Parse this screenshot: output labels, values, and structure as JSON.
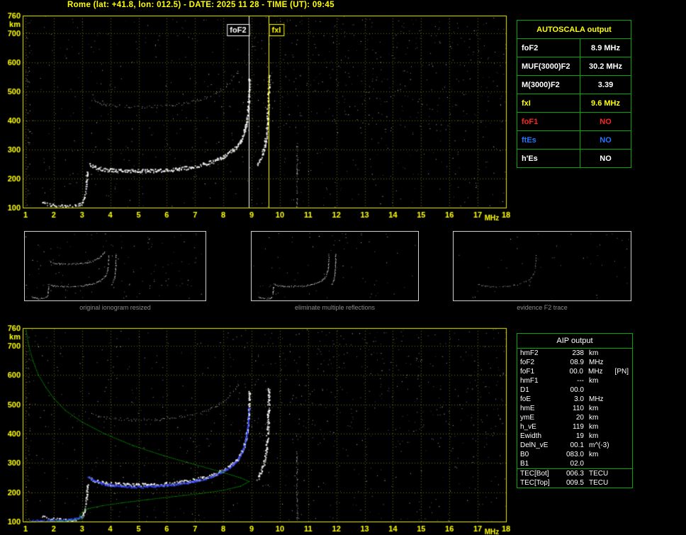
{
  "title": "Rome (lat: +41.8, lon: 012.5) - DATE: 2025 11 28 - TIME (UT): 09:45",
  "autoscala_table": {
    "header": "AUTOSCALA output",
    "rows": [
      {
        "label": "foF2",
        "value": "8.9 MHz",
        "color": "#ffffff"
      },
      {
        "label": "MUF(3000)F2",
        "value": "30.2 MHz",
        "color": "#ffffff"
      },
      {
        "label": "M(3000)F2",
        "value": "3.39",
        "color": "#ffffff"
      },
      {
        "label": "fxI",
        "value": "9.6 MHz",
        "color": "#ffff00"
      },
      {
        "label": "foF1",
        "value": "NO",
        "color": "#ff2222"
      },
      {
        "label": "ftEs",
        "value": "NO",
        "color": "#2277ff"
      },
      {
        "label": "h'Es",
        "value": "NO",
        "color": "#ffffff"
      }
    ]
  },
  "aip_table": {
    "header": "AIP output",
    "rows": [
      {
        "name": "hmF2",
        "value": "238",
        "unit": "km",
        "extra": "",
        "section": 1
      },
      {
        "name": "foF2",
        "value": "08.9",
        "unit": "MHz",
        "extra": "",
        "section": 1
      },
      {
        "name": "foF1",
        "value": "00.0",
        "unit": "MHz",
        "extra": "[PN]",
        "section": 1
      },
      {
        "name": "hmF1",
        "value": "---",
        "unit": "km",
        "extra": "",
        "section": 1
      },
      {
        "name": "D1",
        "value": "00.0",
        "unit": "",
        "extra": "",
        "section": 1
      },
      {
        "name": "foE",
        "value": "3.0",
        "unit": "MHz",
        "extra": "",
        "section": 1
      },
      {
        "name": "hmE",
        "value": "110",
        "unit": "km",
        "extra": "",
        "section": 1
      },
      {
        "name": "ymE",
        "value": "20",
        "unit": "km",
        "extra": "",
        "section": 1
      },
      {
        "name": "h_vE",
        "value": "119",
        "unit": "km",
        "extra": "",
        "section": 1
      },
      {
        "name": "Ewidth",
        "value": "19",
        "unit": "km",
        "extra": "",
        "section": 1
      },
      {
        "name": "DelN_vE",
        "value": "00.1",
        "unit": "m^(-3)",
        "extra": "",
        "section": 1
      },
      {
        "name": "B0",
        "value": "083.0",
        "unit": "km",
        "extra": "",
        "section": 1
      },
      {
        "name": "B1",
        "value": "02.0",
        "unit": "",
        "extra": "",
        "section": 1
      },
      {
        "name": "TEC[Bot]",
        "value": "006.3",
        "unit": "TECU",
        "extra": "",
        "section": 2
      },
      {
        "name": "TEC[Top]",
        "value": "009.5",
        "unit": "TECU",
        "extra": "",
        "section": 2
      }
    ]
  },
  "thumbnails": [
    {
      "caption": "original ionogram resized"
    },
    {
      "caption": "eliminate multiple reflections"
    },
    {
      "caption": "evidence F2 trace"
    }
  ],
  "chart_data": [
    {
      "id": "ionogram_autoscala",
      "type": "scatter",
      "xlabel": "MHz",
      "ylabel": "km",
      "xlim": [
        1,
        18
      ],
      "ylim": [
        100,
        760
      ],
      "x_ticks": [
        1,
        2,
        3,
        4,
        5,
        6,
        7,
        8,
        9,
        10,
        11,
        12,
        13,
        14,
        15,
        16,
        17,
        18
      ],
      "y_ticks": [
        100,
        200,
        300,
        400,
        500,
        600,
        700,
        760
      ],
      "grid": true,
      "axis_color": "#ffff00",
      "interference_mhz": 10.6,
      "markers": [
        {
          "label": "foF2",
          "freq_mhz": 8.9,
          "color": "#ffffff",
          "align": "left"
        },
        {
          "label": "fxI",
          "freq_mhz": 9.6,
          "color": "#ffff00",
          "align": "right"
        }
      ],
      "series": [
        {
          "name": "E-trace",
          "points": [
            [
              1.6,
              118
            ],
            [
              1.85,
              112
            ],
            [
              2.15,
              108
            ],
            [
              2.5,
              106
            ],
            [
              2.8,
              110
            ],
            [
              3.0,
              118
            ],
            [
              3.08,
              136
            ],
            [
              3.13,
              168
            ],
            [
              3.16,
              205
            ],
            [
              3.18,
              230
            ]
          ]
        },
        {
          "name": "F-trace",
          "points": [
            [
              3.25,
              252
            ],
            [
              3.45,
              240
            ],
            [
              3.7,
              233
            ],
            [
              4.0,
              230
            ],
            [
              4.5,
              228
            ],
            [
              5.0,
              227
            ],
            [
              5.5,
              228
            ],
            [
              6.0,
              230
            ],
            [
              6.4,
              234
            ],
            [
              6.8,
              240
            ],
            [
              7.2,
              248
            ],
            [
              7.6,
              259
            ],
            [
              7.9,
              272
            ],
            [
              8.2,
              289
            ],
            [
              8.45,
              310
            ],
            [
              8.6,
              332
            ],
            [
              8.72,
              358
            ],
            [
              8.8,
              390
            ],
            [
              8.85,
              425
            ],
            [
              8.88,
              465
            ],
            [
              8.9,
              510
            ],
            [
              8.91,
              548
            ]
          ]
        },
        {
          "name": "X-asymptote",
          "points": [
            [
              9.2,
              248
            ],
            [
              9.32,
              272
            ],
            [
              9.42,
              300
            ],
            [
              9.49,
              335
            ],
            [
              9.53,
              375
            ],
            [
              9.56,
              420
            ],
            [
              9.58,
              470
            ],
            [
              9.59,
              520
            ],
            [
              9.6,
              558
            ]
          ]
        },
        {
          "name": "second-hop",
          "points": [
            [
              3.35,
              470
            ],
            [
              3.6,
              460
            ],
            [
              3.9,
              454
            ],
            [
              4.3,
              450
            ],
            [
              4.8,
              448
            ],
            [
              5.3,
              448
            ],
            [
              5.8,
              450
            ],
            [
              6.2,
              454
            ],
            [
              6.6,
              459
            ],
            [
              7.0,
              467
            ],
            [
              7.4,
              479
            ],
            [
              7.7,
              494
            ],
            [
              8.0,
              512
            ],
            [
              8.2,
              530
            ],
            [
              8.4,
              553
            ],
            [
              8.55,
              575
            ]
          ]
        }
      ]
    },
    {
      "id": "ionogram_aip",
      "type": "scatter",
      "xlabel": "MHz",
      "ylabel": "km",
      "xlim": [
        1,
        18
      ],
      "ylim": [
        100,
        760
      ],
      "x_ticks": [
        1,
        2,
        3,
        4,
        5,
        6,
        7,
        8,
        9,
        10,
        11,
        12,
        13,
        14,
        15,
        16,
        17,
        18
      ],
      "y_ticks": [
        100,
        200,
        300,
        400,
        500,
        600,
        700,
        760
      ],
      "grid": true,
      "axis_color": "#ffff00",
      "interference_mhz": 10.6,
      "markers": [],
      "series": [
        {
          "name": "E-trace",
          "points": [
            [
              1.6,
              118
            ],
            [
              1.85,
              112
            ],
            [
              2.15,
              108
            ],
            [
              2.5,
              106
            ],
            [
              2.8,
              110
            ],
            [
              3.0,
              118
            ],
            [
              3.08,
              136
            ],
            [
              3.13,
              168
            ],
            [
              3.16,
              205
            ],
            [
              3.18,
              230
            ]
          ]
        },
        {
          "name": "F-trace",
          "points": [
            [
              3.25,
              252
            ],
            [
              3.45,
              240
            ],
            [
              3.7,
              233
            ],
            [
              4.0,
              230
            ],
            [
              4.5,
              228
            ],
            [
              5.0,
              227
            ],
            [
              5.5,
              228
            ],
            [
              6.0,
              230
            ],
            [
              6.4,
              234
            ],
            [
              6.8,
              240
            ],
            [
              7.2,
              248
            ],
            [
              7.6,
              259
            ],
            [
              7.9,
              272
            ],
            [
              8.2,
              289
            ],
            [
              8.45,
              310
            ],
            [
              8.6,
              332
            ],
            [
              8.72,
              358
            ],
            [
              8.8,
              390
            ],
            [
              8.85,
              425
            ],
            [
              8.88,
              465
            ],
            [
              8.9,
              510
            ],
            [
              8.91,
              548
            ]
          ]
        },
        {
          "name": "X-asymptote",
          "points": [
            [
              9.2,
              248
            ],
            [
              9.32,
              272
            ],
            [
              9.42,
              300
            ],
            [
              9.49,
              335
            ],
            [
              9.53,
              375
            ],
            [
              9.56,
              420
            ],
            [
              9.58,
              470
            ],
            [
              9.59,
              520
            ],
            [
              9.6,
              558
            ]
          ]
        },
        {
          "name": "second-hop",
          "points": [
            [
              3.35,
              470
            ],
            [
              3.6,
              460
            ],
            [
              3.9,
              454
            ],
            [
              4.3,
              450
            ],
            [
              4.8,
              448
            ],
            [
              5.3,
              448
            ],
            [
              5.8,
              450
            ],
            [
              6.2,
              454
            ],
            [
              6.6,
              459
            ],
            [
              7.0,
              467
            ],
            [
              7.4,
              479
            ],
            [
              7.7,
              494
            ],
            [
              8.0,
              512
            ],
            [
              8.2,
              530
            ],
            [
              8.4,
              553
            ],
            [
              8.55,
              575
            ]
          ]
        }
      ],
      "overlays": [
        {
          "name": "restored-trace-E",
          "color": "#3344ff",
          "style": "scatter",
          "points": [
            [
              1.2,
              104
            ],
            [
              1.6,
              105
            ],
            [
              2.0,
              106
            ],
            [
              2.4,
              108
            ],
            [
              2.8,
              112
            ],
            [
              3.0,
              117
            ]
          ]
        },
        {
          "name": "restored-trace-F",
          "color": "#3344ff",
          "style": "scatter",
          "points": [
            [
              3.2,
              255
            ],
            [
              3.4,
              240
            ],
            [
              3.7,
              230
            ],
            [
              4.1,
              224
            ],
            [
              4.6,
              221
            ],
            [
              5.1,
              220
            ],
            [
              5.6,
              222
            ],
            [
              6.1,
              226
            ],
            [
              6.5,
              231
            ],
            [
              6.9,
              238
            ],
            [
              7.3,
              247
            ],
            [
              7.7,
              259
            ],
            [
              8.0,
              273
            ],
            [
              8.3,
              292
            ],
            [
              8.5,
              313
            ],
            [
              8.65,
              338
            ],
            [
              8.75,
              368
            ],
            [
              8.82,
              402
            ],
            [
              8.87,
              445
            ],
            [
              8.9,
              495
            ]
          ]
        },
        {
          "name": "electron-density-profile",
          "color": "#00bb00",
          "style": "dots",
          "points": [
            [
              1.0,
              760
            ],
            [
              1.1,
              700
            ],
            [
              1.25,
              650
            ],
            [
              1.45,
              600
            ],
            [
              1.7,
              560
            ],
            [
              2.0,
              520
            ],
            [
              2.4,
              480
            ],
            [
              3.0,
              440
            ],
            [
              3.8,
              400
            ],
            [
              4.8,
              360
            ],
            [
              5.9,
              325
            ],
            [
              7.0,
              295
            ],
            [
              8.0,
              268
            ],
            [
              8.6,
              250
            ],
            [
              8.9,
              238
            ],
            [
              8.6,
              222
            ],
            [
              8.0,
              208
            ],
            [
              7.2,
              197
            ],
            [
              6.3,
              187
            ],
            [
              5.3,
              176
            ],
            [
              4.4,
              165
            ],
            [
              3.7,
              155
            ],
            [
              3.2,
              145
            ],
            [
              3.0,
              134
            ],
            [
              2.92,
              125
            ],
            [
              2.9,
              119
            ],
            [
              3.0,
              110
            ],
            [
              2.6,
              105
            ],
            [
              2.1,
              102
            ],
            [
              1.5,
              100
            ],
            [
              1.05,
              99
            ]
          ]
        }
      ]
    }
  ]
}
